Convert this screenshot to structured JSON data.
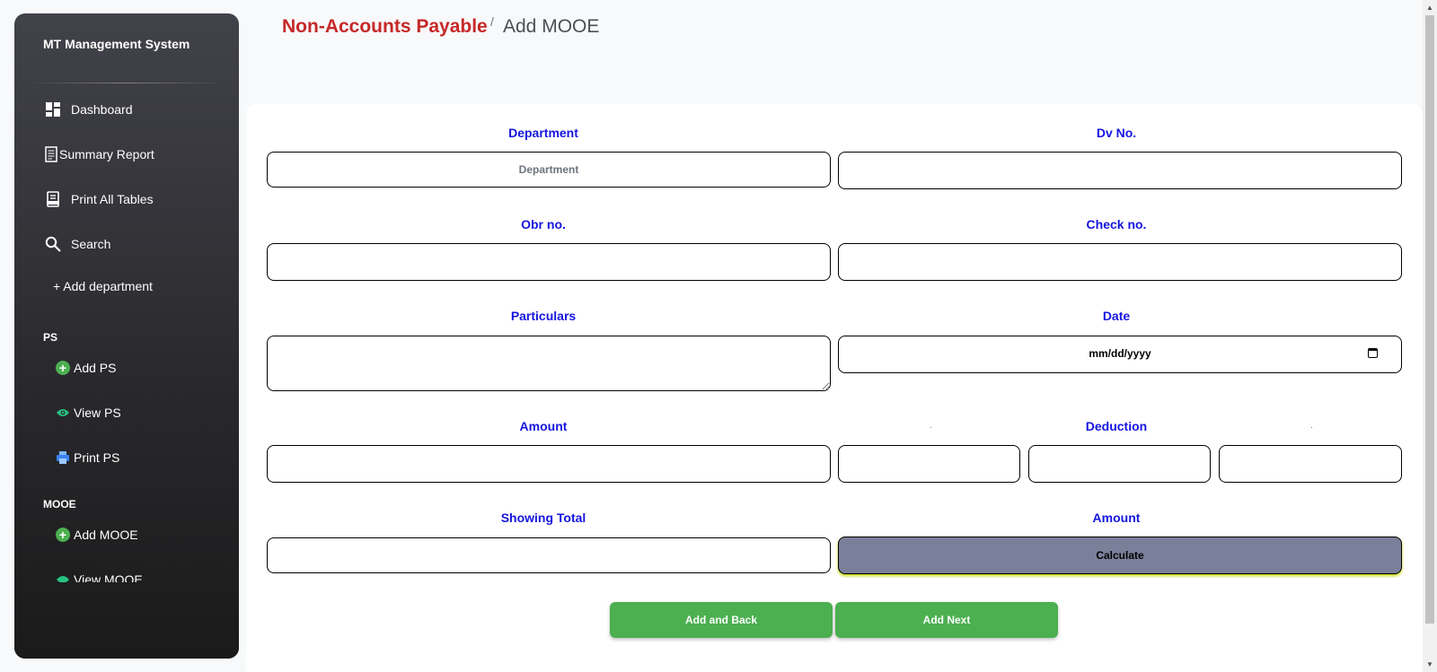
{
  "app": {
    "title": "MT Management System"
  },
  "sidebar": {
    "items": [
      {
        "label": "Dashboard",
        "icon": "dashboard-icon"
      },
      {
        "label": "Summary Report",
        "icon": "report-icon"
      },
      {
        "label": "Print All Tables",
        "icon": "print-icon"
      },
      {
        "label": "Search",
        "icon": "search-icon"
      },
      {
        "label": "+ Add department"
      }
    ],
    "sections": [
      {
        "title": "PS",
        "items": [
          {
            "label": "Add PS",
            "icon": "add-circle-icon"
          },
          {
            "label": "View PS",
            "icon": "eye-icon"
          },
          {
            "label": "Print PS",
            "icon": "printer-icon"
          }
        ]
      },
      {
        "title": "MOOE",
        "items": [
          {
            "label": "Add MOOE",
            "icon": "add-circle-icon"
          },
          {
            "label": "View MOOE",
            "icon": "eye-icon"
          }
        ]
      }
    ]
  },
  "breadcrumb": {
    "main": "Non-Accounts Payable",
    "separator": "/",
    "current": "Add MOOE"
  },
  "form": {
    "department_label": "Department",
    "department_placeholder": "Department",
    "dv_label": "Dv No.",
    "obr_label": "Obr no.",
    "check_label": "Check no.",
    "particulars_label": "Particulars",
    "date_label": "Date",
    "date_placeholder": "mm/dd/yyyy",
    "amount_label": "Amount",
    "deduction_label": "Deduction",
    "dot_marker": ".",
    "showing_total_label": "Showing Total",
    "amount2_label": "Amount",
    "calculate_label": "Calculate"
  },
  "actions": {
    "add_back": "Add and Back",
    "add_next": "Add Next"
  },
  "colors": {
    "accent_red": "#c62828",
    "label_blue": "#1515e0",
    "button_green": "#4caf50",
    "calc_gray": "#7a7f9a"
  }
}
